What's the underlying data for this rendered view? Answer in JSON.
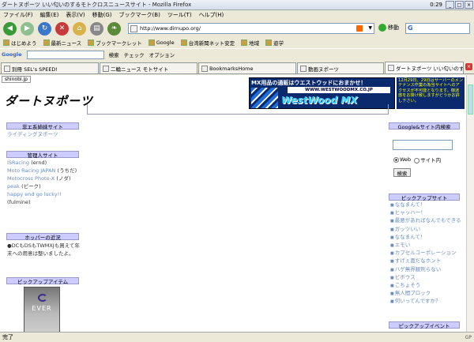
{
  "window": {
    "title": "ダートヌポーツ いい匂いのするモトクロスニュースサイト - Mozilla Firefox",
    "clock": "0:29"
  },
  "menu": [
    "ファイル(F)",
    "編集(E)",
    "表示(V)",
    "移動(G)",
    "ブックマーク(B)",
    "ツール(T)",
    "ヘルプ(H)"
  ],
  "toolbar": {
    "url": "http://www.dirnupo.org/",
    "go_label": "移動",
    "search_engine": "G"
  },
  "bookmarks": [
    "はじめよう",
    "最新ニュース",
    "ブックマークレット",
    "Google",
    "台湾新聞ネット安定",
    "地域",
    "遊学"
  ],
  "google_bar": {
    "logo": "Google",
    "search_label": "検索",
    "check_label": "チェック",
    "options_label": "オプション"
  },
  "tabs": [
    {
      "label": "別冊 SEL's SPEED!"
    },
    {
      "label": "二輪ニュース モトサイト"
    },
    {
      "label": "BookmarksHome"
    },
    {
      "label": "動画ヌポーツ"
    },
    {
      "label": "ダートヌポーツ いい匂いのす..."
    }
  ],
  "page": {
    "site_tag": "shinobi.jp",
    "logo": "ダートヌポーツ",
    "banner_head": "MX用品の通販はウエストウッドにおまかせ！",
    "banner_url": "WWW.WESTWOODMX.CO.JP",
    "banner_brand": "WestWood MX",
    "notice": "12月29日、29日はサーバーのメンテナンス作業の為当サイトへのアクセスが不可能となります。御迷惑をお掛け致しますがどうかお許し下さい。",
    "left": {
      "related_head": "非エ系姉妹サイト",
      "related_link": "ライディングヌポーツ",
      "admin_head": "管理人サイト",
      "admin_items": [
        {
          "link": "ISRacing",
          "who": "(ernd)"
        },
        {
          "link": "Moto Racing JAPAN",
          "who": "(うちだ)"
        },
        {
          "link": "Motocross Photo-X",
          "who": "(ノダ)"
        },
        {
          "link": "peak",
          "who": "(ピーク)"
        },
        {
          "link": "happy end go lucky!!",
          "who": "(fulmine)"
        }
      ],
      "hopper_head": "ホッパーの近況",
      "hopper_text": "●DCもDSもTWMXJも買えて年末への用意は整いましたよ。",
      "pick_item_head": "ピックアップアイテム",
      "pick_item_img": "EVER"
    },
    "right": {
      "search_head": "Google&サイト内検索",
      "radio_web": "Web",
      "radio_site": "サイト内",
      "search_btn": "検索",
      "pickup_head": "ピックアップサイト",
      "pickup_links": [
        "ななまんて！",
        "ヒャッハー！",
        "最悪があればなんでもできる",
        "ガッツいい",
        "ななまんて！",
        "エモい",
        "カプセルコーポレーション",
        "すげぇ面だなホント",
        "ハゲ無界観刑らない",
        "ビボウス",
        "こちょそう",
        "無人間ブロック",
        "何いってんですか？"
      ],
      "pickup_event_head": "ピックアップイベント"
    }
  },
  "status": {
    "text": "完了",
    "right": "GP"
  }
}
